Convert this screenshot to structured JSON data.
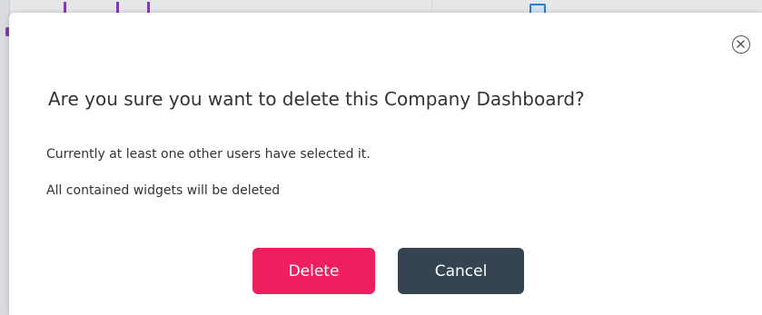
{
  "dialog": {
    "title": "Are you sure you want to delete this Company Dashboard?",
    "message_lines": [
      "Currently at least one other users have selected it.",
      "All contained widgets will be deleted"
    ],
    "buttons": {
      "delete_label": "Delete",
      "cancel_label": "Cancel"
    },
    "close_icon": "close-circle-icon"
  },
  "colors": {
    "delete_button": "#ee1f5f",
    "cancel_button": "#354450",
    "text": "#333333",
    "background": "#ffffff"
  }
}
